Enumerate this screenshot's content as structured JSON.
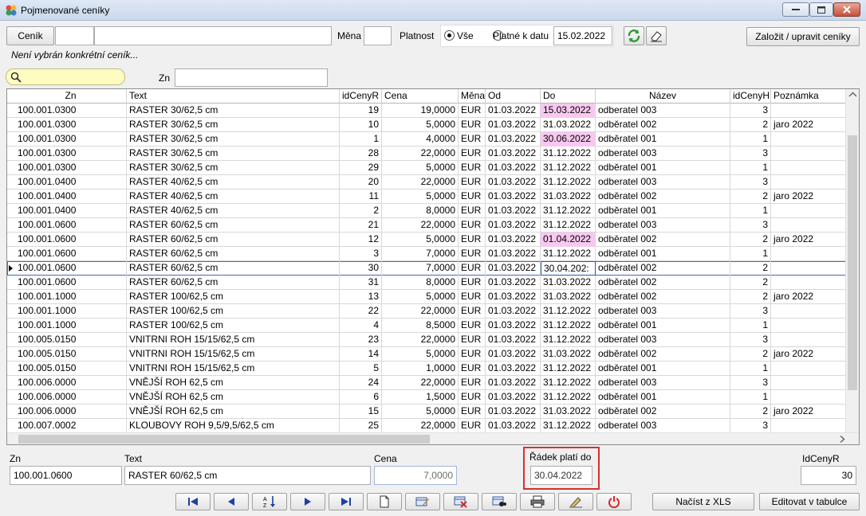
{
  "window": {
    "title": "Pojmenované ceníky",
    "icon": "app-flower-icon",
    "controls": [
      "minimize-icon",
      "maximize-icon",
      "close-icon"
    ]
  },
  "toolbar": {
    "cenik_button": "Ceník",
    "cenik_code": "",
    "cenik_name": "",
    "mena_label": "Měna",
    "mena_value": "",
    "platnost_label": "Platnost",
    "radio_all": "Vše",
    "radio_valid": "Platné k datu",
    "date_value": "15.02.2022",
    "refresh_icon": "refresh-icon",
    "eraser_icon": "eraser-icon",
    "create_button": "Založit / upravit ceníky",
    "status": "Není vybrán konkrétní ceník..."
  },
  "filter": {
    "search_icon": "search-icon",
    "search_value": "",
    "zn_label": "Zn",
    "zn_value": ""
  },
  "grid": {
    "columns": [
      "Zn",
      "Text",
      "idCenyR",
      "Cena",
      "Měna",
      "Od",
      "Do",
      "Název",
      "idCenyH",
      "Poznámka"
    ],
    "rows": [
      [
        "100.001.0300",
        "RASTER  30/62,5 cm",
        "19",
        "19,0000",
        "EUR",
        "01.03.2022",
        "15.03.2022",
        "odberatel 003",
        "3",
        ""
      ],
      [
        "100.001.0300",
        "RASTER  30/62,5 cm",
        "10",
        "5,0000",
        "EUR",
        "01.03.2022",
        "31.03.2022",
        "odběratel 002",
        "2",
        "jaro 2022"
      ],
      [
        "100.001.0300",
        "RASTER  30/62,5 cm",
        "1",
        "4,0000",
        "EUR",
        "01.03.2022",
        "30.06.2022",
        "odběratel 001",
        "1",
        ""
      ],
      [
        "100.001.0300",
        "RASTER  30/62,5 cm",
        "28",
        "22,0000",
        "EUR",
        "01.03.2022",
        "31.12.2022",
        "odberatel 003",
        "3",
        ""
      ],
      [
        "100.001.0300",
        "RASTER  30/62,5 cm",
        "29",
        "5,0000",
        "EUR",
        "01.03.2022",
        "31.12.2022",
        "odběratel 001",
        "1",
        ""
      ],
      [
        "100.001.0400",
        "RASTER  40/62,5 cm",
        "20",
        "22,0000",
        "EUR",
        "01.03.2022",
        "31.12.2022",
        "odberatel 003",
        "3",
        ""
      ],
      [
        "100.001.0400",
        "RASTER  40/62,5 cm",
        "11",
        "5,0000",
        "EUR",
        "01.03.2022",
        "31.03.2022",
        "odběratel 002",
        "2",
        "jaro 2022"
      ],
      [
        "100.001.0400",
        "RASTER  40/62,5 cm",
        "2",
        "8,0000",
        "EUR",
        "01.03.2022",
        "31.12.2022",
        "odběratel 001",
        "1",
        ""
      ],
      [
        "100.001.0600",
        "RASTER  60/62,5 cm",
        "21",
        "22,0000",
        "EUR",
        "01.03.2022",
        "31.12.2022",
        "odberatel 003",
        "3",
        ""
      ],
      [
        "100.001.0600",
        "RASTER  60/62,5 cm",
        "12",
        "5,0000",
        "EUR",
        "01.03.2022",
        "01.04.2022",
        "odběratel 002",
        "2",
        "jaro 2022"
      ],
      [
        "100.001.0600",
        "RASTER  60/62,5 cm",
        "3",
        "7,0000",
        "EUR",
        "01.03.2022",
        "31.12.2022",
        "odběratel 001",
        "1",
        ""
      ],
      [
        "100.001.0600",
        "RASTER  60/62,5 cm",
        "30",
        "7,0000",
        "EUR",
        "01.03.2022",
        "30.04.202:",
        "odběratel 002",
        "2",
        ""
      ],
      [
        "100.001.0600",
        "RASTER  60/62,5 cm",
        "31",
        "8,0000",
        "EUR",
        "01.03.2022",
        "31.03.2022",
        "odběratel 002",
        "2",
        ""
      ],
      [
        "100.001.1000",
        "RASTER 100/62,5 cm",
        "13",
        "5,0000",
        "EUR",
        "01.03.2022",
        "31.03.2022",
        "odběratel 002",
        "2",
        "jaro 2022"
      ],
      [
        "100.001.1000",
        "RASTER 100/62,5 cm",
        "22",
        "22,0000",
        "EUR",
        "01.03.2022",
        "31.12.2022",
        "odberatel 003",
        "3",
        ""
      ],
      [
        "100.001.1000",
        "RASTER 100/62,5 cm",
        "4",
        "8,5000",
        "EUR",
        "01.03.2022",
        "31.12.2022",
        "odběratel 001",
        "1",
        ""
      ],
      [
        "100.005.0150",
        "VNITRNI ROH 15/15/62,5 cm",
        "23",
        "22,0000",
        "EUR",
        "01.03.2022",
        "31.12.2022",
        "odberatel 003",
        "3",
        ""
      ],
      [
        "100.005.0150",
        "VNITRNI ROH 15/15/62,5 cm",
        "14",
        "5,0000",
        "EUR",
        "01.03.2022",
        "31.03.2022",
        "odběratel 002",
        "2",
        "jaro 2022"
      ],
      [
        "100.005.0150",
        "VNITRNI ROH 15/15/62,5 cm",
        "5",
        "1,0000",
        "EUR",
        "01.03.2022",
        "31.12.2022",
        "odběratel 001",
        "1",
        ""
      ],
      [
        "100.006.0000",
        "VNĚJŠÍ ROH 62,5 cm",
        "24",
        "22,0000",
        "EUR",
        "01.03.2022",
        "31.12.2022",
        "odberatel 003",
        "3",
        ""
      ],
      [
        "100.006.0000",
        "VNĚJŠÍ ROH 62,5 cm",
        "6",
        "1,5000",
        "EUR",
        "01.03.2022",
        "31.12.2022",
        "odběratel 001",
        "1",
        ""
      ],
      [
        "100.006.0000",
        "VNĚJŠÍ ROH 62,5 cm",
        "15",
        "5,0000",
        "EUR",
        "01.03.2022",
        "31.03.2022",
        "odběratel 002",
        "2",
        "jaro 2022"
      ],
      [
        "100.007.0002",
        "KLOUBOVY ROH 9,5/9,5/62,5 cm",
        "25",
        "22,0000",
        "EUR",
        "01.03.2022",
        "31.12.2022",
        "odberatel 003",
        "3",
        ""
      ]
    ],
    "highlighted_do_rows": [
      0,
      2,
      9
    ],
    "selected_row": 11,
    "highlight_color": "#f8c8f0"
  },
  "detail": {
    "zn_label": "Zn",
    "zn_value": "100.001.0600",
    "text_label": "Text",
    "text_value": "RASTER  60/62,5 cm",
    "cena_label": "Cena",
    "cena_value": "7,0000",
    "radek_label": "Řádek platí do",
    "radek_value": "30.04.2022",
    "idcenyr_label": "IdCenyR",
    "idcenyr_value": "30"
  },
  "bottom": {
    "nav_icons": [
      "first-record-icon",
      "previous-record-icon",
      "sort-az-icon",
      "next-record-icon",
      "last-record-icon",
      "new-record-icon",
      "edit-record-icon",
      "delete-record-icon",
      "find-record-icon",
      "print-icon",
      "edit-pen-icon",
      "power-icon"
    ],
    "load_xls_button": "Načíst z XLS",
    "edit_table_button": "Editovat v tabulce"
  }
}
